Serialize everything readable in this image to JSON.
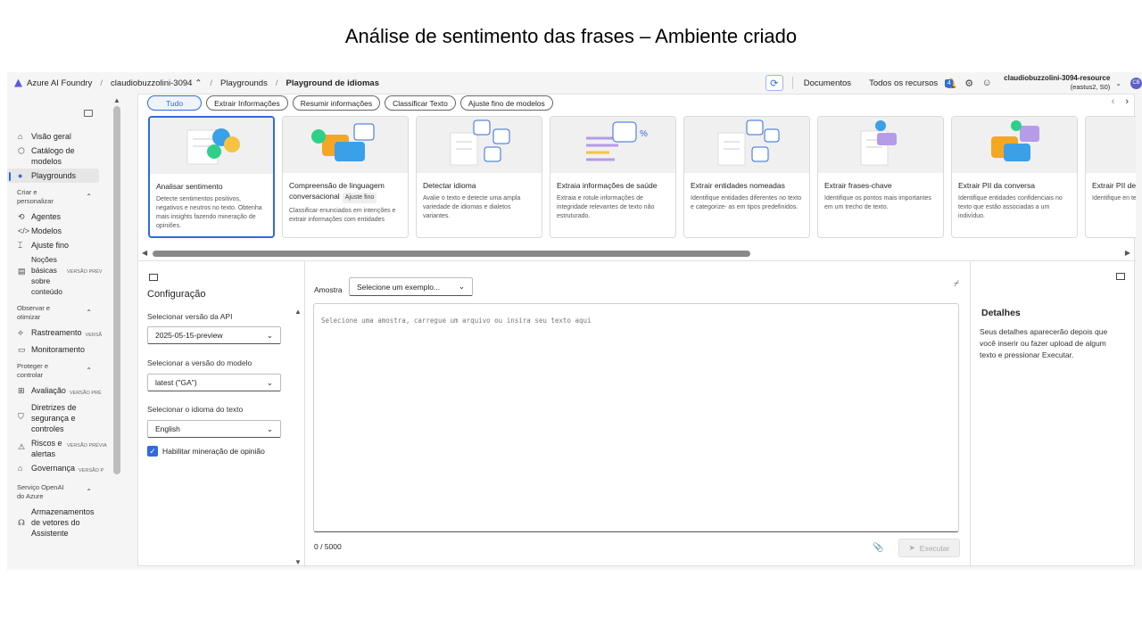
{
  "slide_title": "Análise de sentimento das frases – Ambiente criado",
  "header": {
    "app_name": "Azure AI Foundry",
    "project": "claudiobuzzolini-3094",
    "crumb1": "Playgrounds",
    "crumb2": "Playground de idiomas",
    "docs": "Documentos",
    "resources": "Todos os recursos",
    "notif_count": "4",
    "account_name": "claudiobuzzolini-3094-resource",
    "account_region": "(eastus2, S0)",
    "avatar_initials": "CB"
  },
  "sidebar": {
    "items": [
      {
        "label": "Visão geral",
        "icon": "home-icon"
      },
      {
        "label": "Catálogo de modelos",
        "icon": "cube-icon"
      },
      {
        "label": "Playgrounds",
        "icon": "chat-icon"
      }
    ],
    "section_criar": "Criar e personalizar",
    "criar_items": [
      {
        "label": "Agentes",
        "icon": "agent-icon"
      },
      {
        "label": "Modelos",
        "icon": "code-icon"
      },
      {
        "label": "Ajuste fino",
        "icon": "tune-icon"
      },
      {
        "label": "Noções básicas sobre conteúdo",
        "tag": "VERSÃO PRÉV"
      }
    ],
    "section_observar": "Observar e otimizar",
    "observar_items": [
      {
        "label": "Rastreamento",
        "tag": "VERSÃ"
      },
      {
        "label": "Monitoramento"
      }
    ],
    "section_proteger": "Proteger e controlar",
    "proteger_items": [
      {
        "label": "Avaliação",
        "tag": "VERSÃO PRÉ"
      },
      {
        "label": "Diretrizes de segurança e controles"
      },
      {
        "label": "Riscos e alertas",
        "tag": "VERSÃO PRÉVIA"
      },
      {
        "label": "Governança",
        "tag": "VERSÃO P"
      }
    ],
    "section_openai": "Serviço OpenAI do Azure",
    "openai_items": [
      {
        "label": "Armazenamentos de vetores do Assistente"
      }
    ]
  },
  "chips": [
    "Tudo",
    "Extrair Informações",
    "Resumir informações",
    "Classificar Texto",
    "Ajuste fino de modelos"
  ],
  "cards": [
    {
      "title": "Analisar sentimento",
      "desc": "Detecte sentimentos positivos, negativos e neutros no texto. Obtenha mais insights fazendo mineração de opiniões."
    },
    {
      "title": "Compreensão de linguagem conversacional",
      "pill": "Ajuste fino",
      "desc": "Classificar enunciados em intenções e extrair informações com entidades"
    },
    {
      "title": "Detectar idioma",
      "desc": "Avalie o texto e detecte uma ampla variedade de idiomas e dialetos variantes."
    },
    {
      "title": "Extraia informações de saúde",
      "desc": "Extraia e rotule informações de integridade relevantes de texto não estruturado."
    },
    {
      "title": "Extrair entidades nomeadas",
      "desc": "Identifique entidades diferentes no texto e categorize- as em tipos predefinidos."
    },
    {
      "title": "Extrair frases-chave",
      "desc": "Identifique os pontos mais importantes em um trecho de texto."
    },
    {
      "title": "Extrair PII da conversa",
      "desc": "Identifique entidades confidenciais no texto que estão associadas a um indivíduo."
    },
    {
      "title": "Extrair PII de",
      "desc": "Identifique en texto que estã indivíduo."
    }
  ],
  "config": {
    "title": "Configuração",
    "api_label": "Selecionar versão da API",
    "api_value": "2025-05-15-preview",
    "model_label": "Selecionar a versão do modelo",
    "model_value": "latest (\"GA\")",
    "lang_label": "Selecionar o idioma do texto",
    "lang_value": "English",
    "opinion_label": "Habilitar mineração de opinião"
  },
  "sample": {
    "label": "Amostra",
    "select_value": "Selecione um exemplo...",
    "placeholder": "Selecione uma amostra, carregue um arquivo ou insira seu texto aqui",
    "counter": "0 / 5000",
    "run_label": "Executar"
  },
  "details": {
    "title": "Detalhes",
    "text": "Seus detalhes aparecerão depois que você inserir ou fazer upload de algum texto e pressionar Executar."
  }
}
